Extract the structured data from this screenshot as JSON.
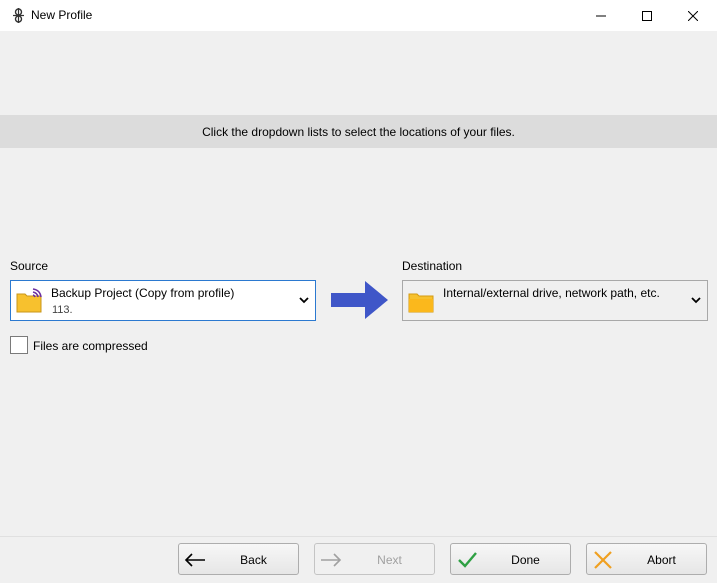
{
  "window": {
    "title": "New Profile",
    "icon": "app-logo-icon",
    "controls": [
      "minimize-icon",
      "maximize-icon",
      "close-icon"
    ]
  },
  "instructions": "Click the dropdown lists to select the locations of your files.",
  "source": {
    "label": "Source",
    "selected_title": "Backup Project (Copy from profile)",
    "selected_subtitle": "113.",
    "icon": "folder-profile-icon"
  },
  "destination": {
    "label": "Destination",
    "selected_title": "Internal/external drive, network path, etc.",
    "icon": "folder-icon"
  },
  "direction_icon": "right-arrow-icon",
  "compressed": {
    "label": "Files are compressed",
    "checked": false
  },
  "buttons": {
    "back": "Back",
    "next": "Next",
    "done": "Done",
    "abort": "Abort"
  },
  "colors": {
    "accent": "#2b79d0",
    "arrow": "#3f56c8",
    "folder": "#f7c12e",
    "done_check": "#2ea043",
    "abort_x": "#f0a020"
  }
}
